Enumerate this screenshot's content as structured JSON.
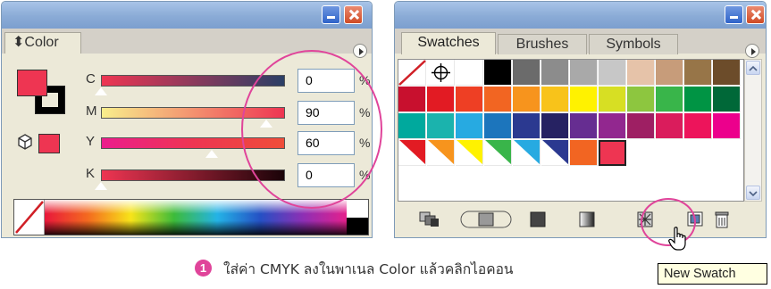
{
  "color_panel": {
    "tab_label": "⬍Color",
    "sliders": [
      {
        "channel": "C",
        "value": "0",
        "unit": "%",
        "level": 0.0
      },
      {
        "channel": "M",
        "value": "90",
        "unit": "%",
        "level": 0.9
      },
      {
        "channel": "Y",
        "value": "60",
        "unit": "%",
        "level": 0.6
      },
      {
        "channel": "K",
        "value": "0",
        "unit": "%",
        "level": 0.0
      }
    ],
    "fill_color": "#ee3552"
  },
  "swatches_panel": {
    "tabs": [
      "Swatches",
      "Brushes",
      "Symbols"
    ],
    "active_tab": "Swatches",
    "swatch_rows": [
      [
        "none",
        "registration",
        "#ffffff",
        "#000000",
        "#6b6b6b",
        "#8c8c8c",
        "#a9a9a9",
        "#c7c7c7",
        "#e6c3a9",
        "#c79c7a",
        "#977548",
        "#6c4c2a"
      ],
      [
        "#c8102e",
        "#e21b23",
        "#ee3f24",
        "#f26522",
        "#f7941d",
        "#f8c31a",
        "#fff200",
        "#d7df23",
        "#8dc63f",
        "#39b54a",
        "#009444",
        "#006838"
      ],
      [
        "#00a99d",
        "#1bb3ad",
        "#27aae1",
        "#1c75bc",
        "#2b3990",
        "#262262",
        "#662d91",
        "#92278f",
        "#9e1f63",
        "#da1c5c",
        "#ed145b",
        "#ec008c"
      ],
      [
        "pattern:#e21b23",
        "pattern:#f7941d",
        "pattern:#fff200",
        "pattern:#39b54a",
        "pattern:#27aae1",
        "pattern:#2b3990",
        "#f26522",
        "#ee3552"
      ]
    ]
  },
  "caption": {
    "step_number": "1",
    "text": "ใส่ค่า CMYK ลงในพาเนล Color แล้วคลิกไอคอน"
  },
  "tooltip": {
    "text": "New Swatch"
  },
  "colors": {
    "highlight": "#e0449a",
    "panel_bg": "#ece9d8",
    "titlebar": "#8aabd6"
  }
}
